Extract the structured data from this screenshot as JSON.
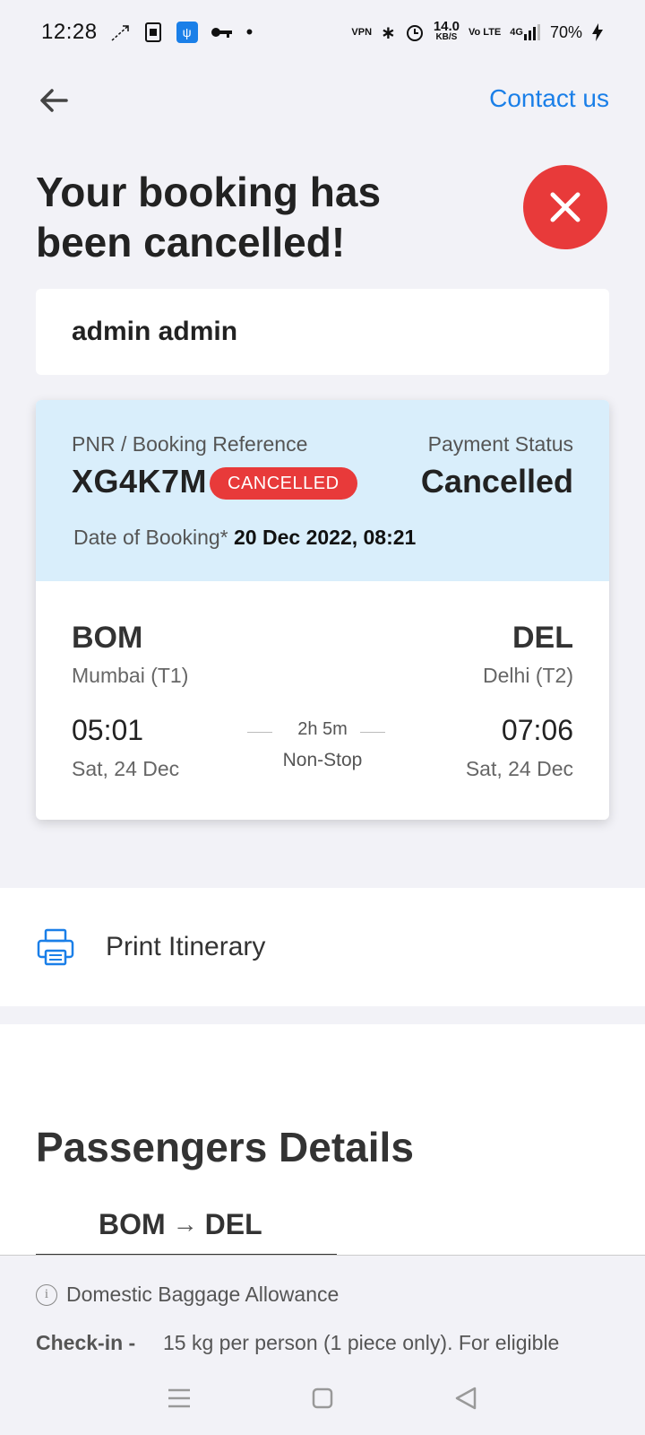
{
  "status_bar": {
    "time": "12:28",
    "speed_value": "14.0",
    "speed_unit": "KB/S",
    "network": "4G",
    "battery": "70%"
  },
  "header": {
    "contact_label": "Contact us"
  },
  "title": "Your booking has been cancelled!",
  "passenger_name": "admin admin",
  "booking": {
    "pnr_label": "PNR / Booking Reference",
    "pnr": "XG4K7M",
    "pnr_status": "CANCELLED",
    "payment_label": "Payment Status",
    "payment_status": "Cancelled",
    "date_label": "Date of Booking*",
    "date_value": "20 Dec 2022, 08:21",
    "from_code": "BOM",
    "from_city": "Mumbai (T1)",
    "to_code": "DEL",
    "to_city": "Delhi (T2)",
    "dep_time": "05:01",
    "dep_date": "Sat, 24 Dec",
    "arr_time": "07:06",
    "arr_date": "Sat, 24 Dec",
    "duration": "2h 5m",
    "stops": "Non-Stop"
  },
  "print_label": "Print Itinerary",
  "passengers": {
    "title": "Passengers Details",
    "route_from": "BOM",
    "route_arrow": "→",
    "route_to": "DEL",
    "baggage_title": "Domestic Baggage Allowance",
    "checkin_key": "Check-in -",
    "checkin_value": "15 kg per person (1 piece only). For eligible"
  },
  "colors": {
    "accent": "#1a7fe8",
    "cancel_red": "#e83a3a",
    "card_highlight": "#d9eefb"
  },
  "icons": [
    "back-arrow-icon",
    "close-icon",
    "printer-icon",
    "info-icon",
    "menu-icon",
    "home-icon",
    "back-nav-icon"
  ]
}
